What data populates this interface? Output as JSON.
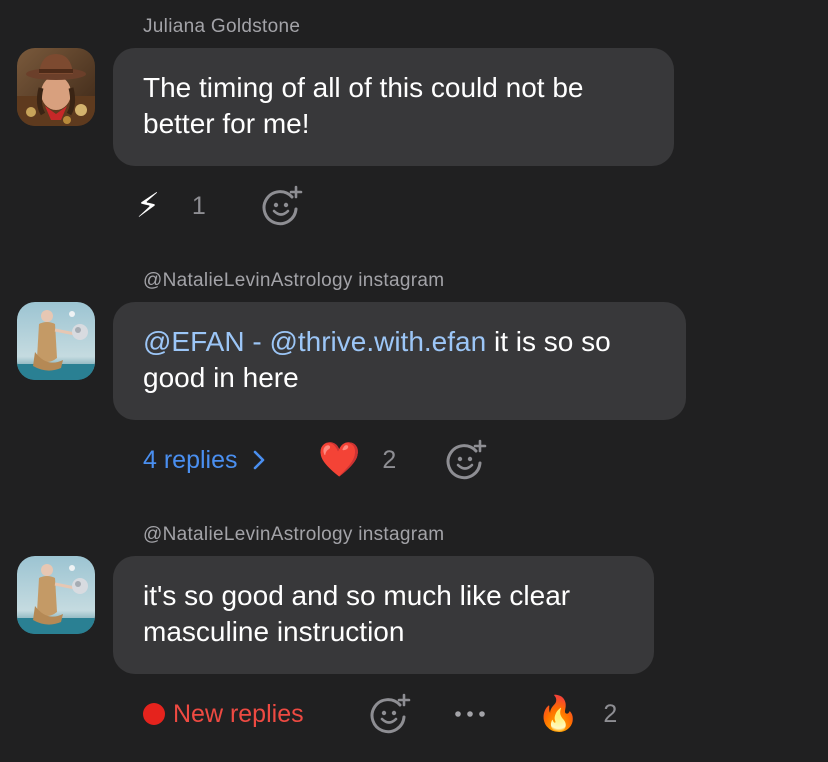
{
  "messages": [
    {
      "author": "Juliana Goldstone",
      "text_plain": "The timing of all of this could not be better for me!",
      "reactions": [
        {
          "emoji": "⚡",
          "count": "1"
        }
      ],
      "add_reaction_icon": "add-emoji-icon"
    },
    {
      "author": "@NatalieLevinAstrology instagram",
      "mention_1": "@EFAN - @thrive.with.efan",
      "text_rest": " it is so so good in here",
      "replies_label": "4 replies",
      "reactions": [
        {
          "emoji": "❤️",
          "count": "2"
        }
      ],
      "add_reaction_icon": "add-emoji-icon"
    },
    {
      "author": "@NatalieLevinAstrology instagram",
      "text_plain": "it's so good and so much like clear masculine instruction",
      "new_replies_label": "New replies",
      "reactions": [
        {
          "emoji": "🔥",
          "count": "2"
        }
      ],
      "add_reaction_icon": "add-emoji-icon",
      "more_icon": "more-horizontal-icon"
    }
  ],
  "colors": {
    "background": "#202021",
    "bubble": "#38383a",
    "mention": "#9cc6f7",
    "link": "#4a8ff0",
    "new_replies": "#ee4a42",
    "muted": "#8e8e93"
  }
}
